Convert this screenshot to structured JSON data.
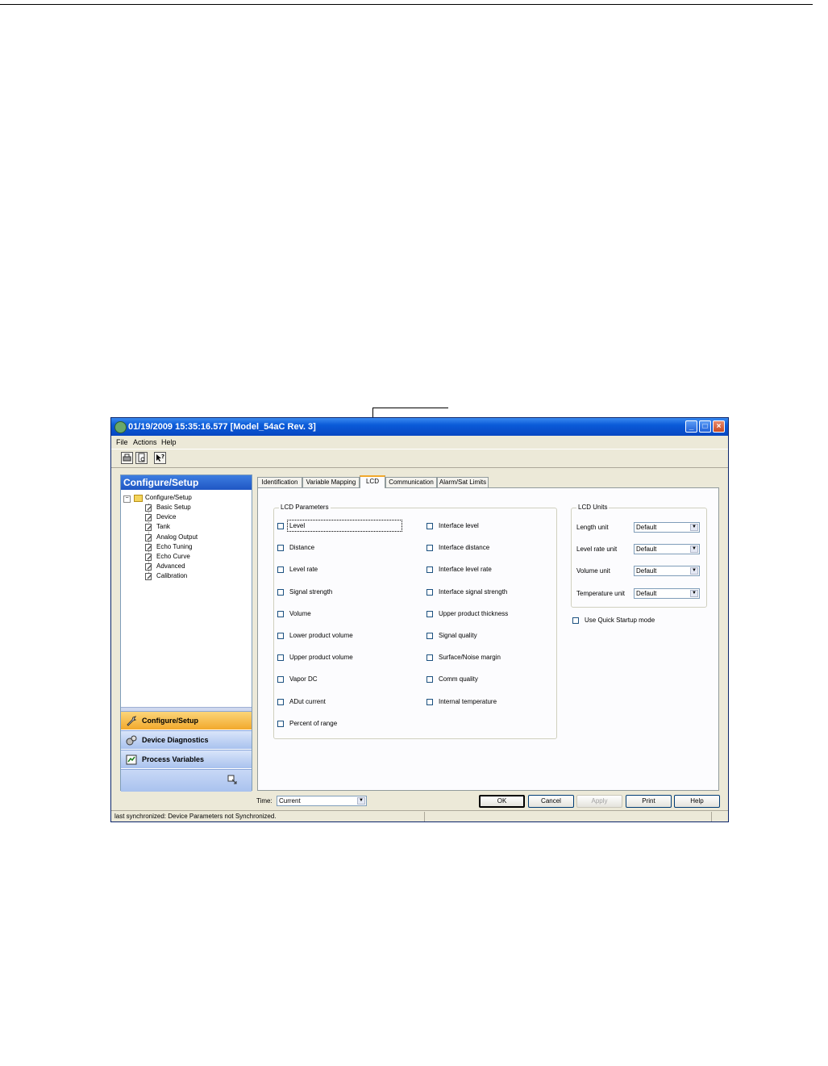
{
  "window": {
    "title": "01/19/2009 15:35:16.577 [Model_54aC Rev. 3]",
    "controls": {
      "minimize": "_",
      "maximize": "□",
      "close": "×"
    }
  },
  "menu": [
    "File",
    "Actions",
    "Help"
  ],
  "toolbar": {
    "icons": [
      "print-icon",
      "print-preview-icon",
      "help-pointer-icon"
    ]
  },
  "left_pane": {
    "header": "Configure/Setup",
    "tree_root": "Configure/Setup",
    "tree_items": [
      "Basic Setup",
      "Device",
      "Tank",
      "Analog Output",
      "Echo Tuning",
      "Echo Curve",
      "Advanced",
      "Calibration"
    ],
    "nav_buttons": [
      {
        "label": "Configure/Setup",
        "active": true
      },
      {
        "label": "Device Diagnostics",
        "active": false
      },
      {
        "label": "Process Variables",
        "active": false
      }
    ]
  },
  "tabs": [
    "Identification",
    "Variable Mapping",
    "LCD",
    "Communication",
    "Alarm/Sat Limits"
  ],
  "active_tab": "LCD",
  "lcd_parameters": {
    "title": "LCD Parameters",
    "left_column": [
      "Level",
      "Distance",
      "Level rate",
      "Signal strength",
      "Volume",
      "Lower product volume",
      "Upper product volume",
      "Vapor DC",
      "ADut current",
      "Percent of range"
    ],
    "right_column": [
      "Interface level",
      "Interface distance",
      "Interface level rate",
      "Interface signal strength",
      "Upper product thickness",
      "Signal quality",
      "Surface/Noise margin",
      "Comm quality",
      "Internal temperature"
    ]
  },
  "lcd_units": {
    "title": "LCD Units",
    "rows": [
      {
        "label": "Length unit",
        "value": "Default"
      },
      {
        "label": "Level rate unit",
        "value": "Default"
      },
      {
        "label": "Volume unit",
        "value": "Default"
      },
      {
        "label": "Temperature unit",
        "value": "Default"
      }
    ]
  },
  "quick_startup": "Use Quick Startup mode",
  "bottom": {
    "time_label": "Time:",
    "time_value": "Current",
    "buttons": [
      "OK",
      "Cancel",
      "Apply",
      "Print",
      "Help"
    ]
  },
  "status": "last synchronized: Device Parameters not Synchronized."
}
